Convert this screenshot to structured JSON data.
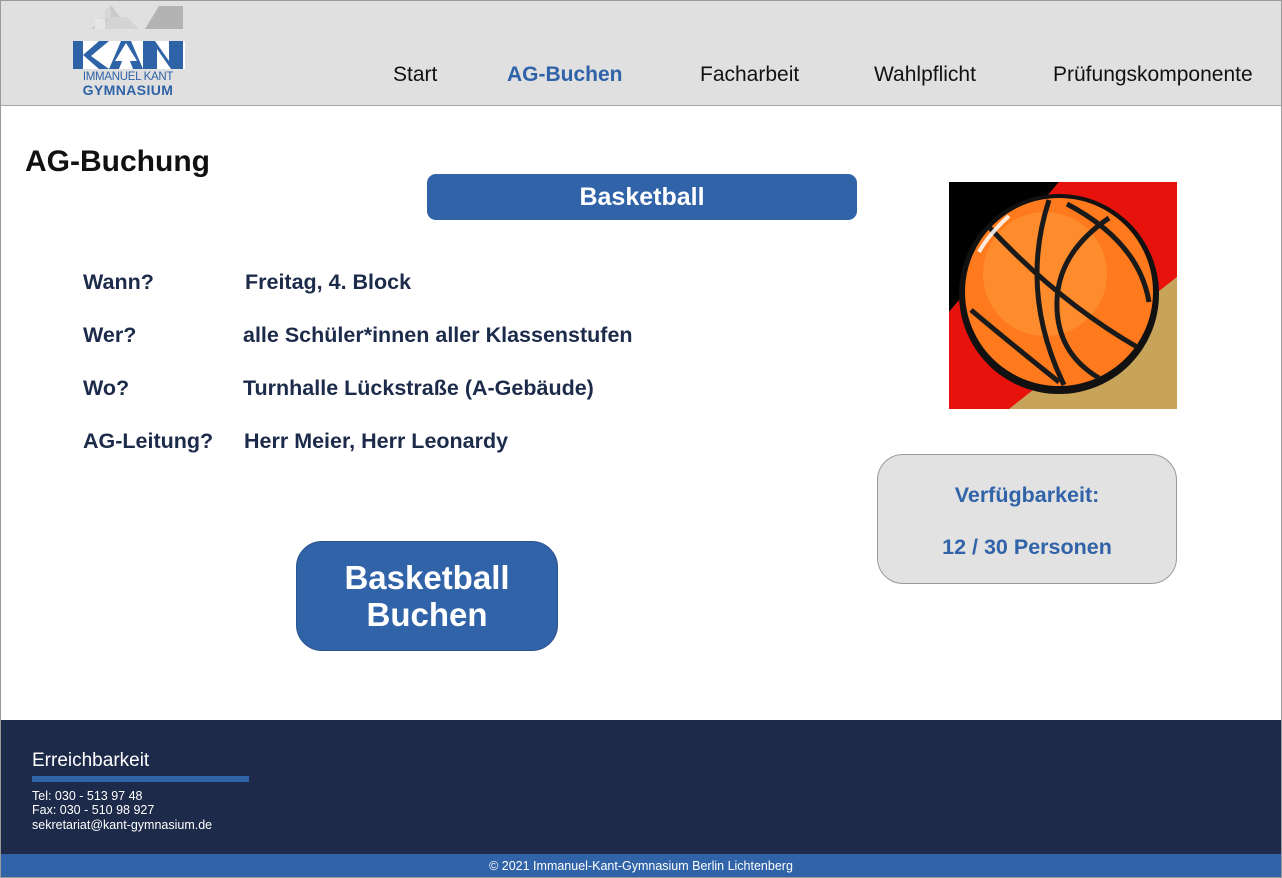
{
  "logo": {
    "line1": "IMMANUEL KANT",
    "line2": "GYMNASIUM"
  },
  "nav": {
    "items": [
      {
        "label": "Start",
        "active": false
      },
      {
        "label": "AG-Buchen",
        "active": true
      },
      {
        "label": "Facharbeit",
        "active": false
      },
      {
        "label": "Wahlpflicht",
        "active": false
      },
      {
        "label": "Prüfungskomponente",
        "active": false
      }
    ]
  },
  "main": {
    "title": "AG-Buchung",
    "ag_name": "Basketball",
    "details": [
      {
        "label": "Wann?",
        "value": "Freitag, 4. Block"
      },
      {
        "label": "Wer?",
        "value": "alle Schüler*innen aller Klassenstufen"
      },
      {
        "label": "Wo?",
        "value": "Turnhalle Lückstraße (A-Gebäude)"
      },
      {
        "label": "AG-Leitung?",
        "value": "Herr Meier, Herr Leonardy"
      }
    ],
    "availability": {
      "label": "Verfügbarkeit:",
      "value": "12 / 30 Personen"
    },
    "book_button": {
      "line1": "Basketball",
      "line2": "Buchen"
    },
    "image": "basketball-image"
  },
  "footer": {
    "title": "Erreichbarkeit",
    "tel": "Tel:  030 - 513 97 48",
    "fax": "Fax: 030 - 510 98 927",
    "email": "sekretariat@kant-gymnasium.de",
    "copyright": "© 2021 Immanuel-Kant-Gymnasium Berlin Lichtenberg"
  },
  "colors": {
    "accent": "#3163a8",
    "header_bg": "#e0e0e0",
    "footer_bg": "#1e2a49",
    "text_dark": "#1d2b4b"
  }
}
